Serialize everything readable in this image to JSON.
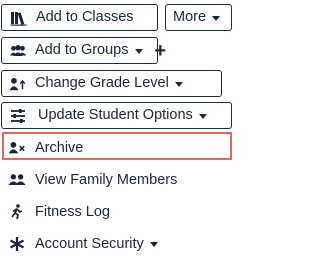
{
  "toolbar": {
    "add_to_classes": "Add to Classes",
    "more": "More",
    "add_to_groups": "Add to Groups",
    "add_plus": "+",
    "change_grade_level": "Change Grade Level",
    "update_student_options": "Update Student Options"
  },
  "menu": {
    "items": [
      {
        "label": "Archive",
        "icon": "user-x-icon"
      },
      {
        "label": "View Family Members",
        "icon": "users-icon"
      },
      {
        "label": "Fitness Log",
        "icon": "running-icon"
      },
      {
        "label": "Account Security",
        "icon": "asterisk-icon"
      }
    ]
  },
  "colors": {
    "text": "#1a2540",
    "border": "#1d2a4d",
    "highlight": "#e8655a"
  }
}
